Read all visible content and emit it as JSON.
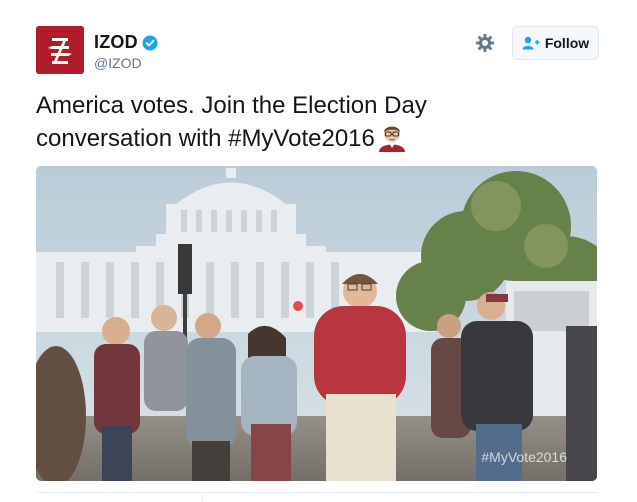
{
  "account": {
    "display_name": "IZOD",
    "handle": "@IZOD",
    "verified": true,
    "avatar_bg": "#b11c2c"
  },
  "actions": {
    "settings_icon": "gear-icon",
    "follow_label": "Follow",
    "follow_icon": "add-user-icon"
  },
  "tweet": {
    "text_line1": "America votes. Join the Election Day",
    "text_line2_prefix": "conversation with ",
    "hashtag": "#MyVote2016",
    "emoji": "voter-emoji"
  },
  "media": {
    "type": "gif-video",
    "watermark": "#MyVote2016"
  },
  "colors": {
    "verified_blue": "#1da1f2",
    "text": "#14171a",
    "muted": "#657786"
  }
}
